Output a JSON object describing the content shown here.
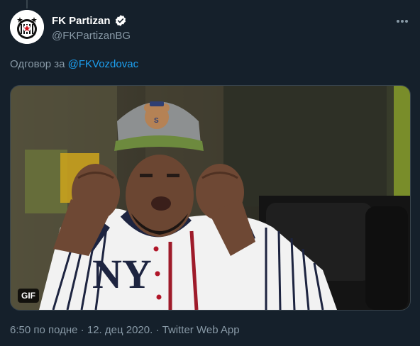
{
  "account": {
    "display_name": "FK Partizan",
    "handle": "@FKPartizanBG"
  },
  "reply": {
    "prefix": "Одговор за",
    "mention": "@FKVozdovac"
  },
  "media": {
    "badge": "GIF"
  },
  "meta": {
    "time": "6:50 по подне",
    "sep1": " · ",
    "date": "12. дец 2020.",
    "sep2": " · ",
    "source": "Twitter Web App"
  },
  "colors": {
    "background": "#15202b",
    "link": "#1da1f2",
    "secondary_text": "#8899a6",
    "verified": "#1da1f2"
  }
}
